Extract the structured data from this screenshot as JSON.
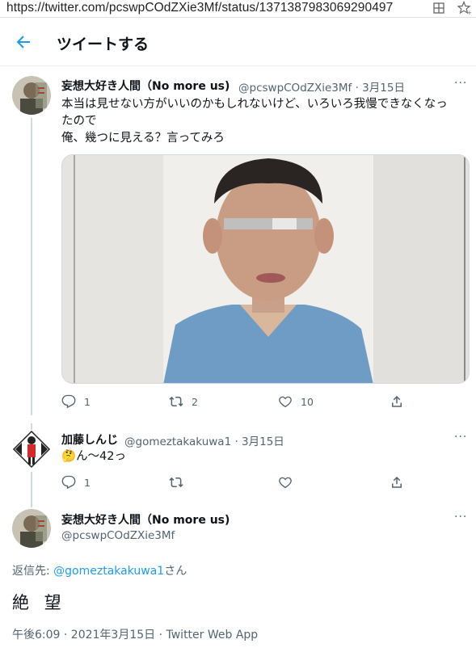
{
  "browser": {
    "url": "https://twitter.com/pcswpCOdZXie3Mf/status/1371387983069290497",
    "icons": [
      "reader-mode-icon",
      "favorite-star-icon"
    ]
  },
  "header": {
    "title": "ツイートする",
    "back_icon": "arrow-left-icon"
  },
  "tweet1": {
    "name": "妄想大好き人間（No more us)",
    "handle_date": "@pcswpCOdZXie3Mf · 3月15日",
    "text_line1": "本当は見せない方がいいのかもしれないけど、いろいろ我慢できなくなっ",
    "text_line2": "たので",
    "text_line3": "俺、幾つに見える？言ってみろ",
    "more": "···",
    "actions": {
      "reply": "1",
      "retweet": "2",
      "like": "10"
    }
  },
  "reply": {
    "name": "加藤しんじ",
    "handle_date": "@gomeztakakuwa1 · 3月15日",
    "emoji": "🤔",
    "text": "ん〜42っ",
    "more": "···",
    "actions": {
      "reply": "1"
    }
  },
  "main_tweet": {
    "name": "妄想大好き人間（No more us)",
    "handle": "@pcswpCOdZXie3Mf",
    "more": "···",
    "replying_prefix": "返信先: ",
    "replying_mention": "@gomeztakakuwa1",
    "replying_suffix": "さん",
    "text": "絶 望",
    "timestamp": "午後6:09 · 2021年3月15日 · Twitter Web App"
  },
  "colors": {
    "accent": "#1d9bf0",
    "secondary_text": "#536471",
    "primary_text": "#0f1419",
    "divider": "#eff3f4"
  }
}
